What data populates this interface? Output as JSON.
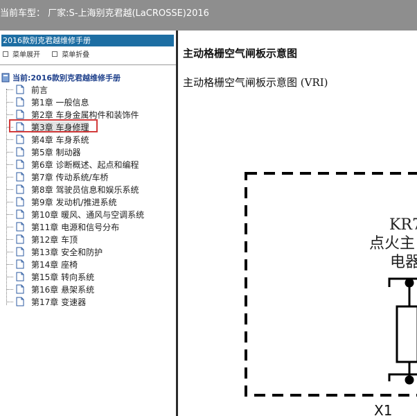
{
  "header": {
    "vehicle_text": "当前车型： 厂家:S-上海别克君越(LaCROSSE)2016"
  },
  "sidebar": {
    "manual_title": "2016款别克君越维修手册",
    "menu": {
      "expand_label": "菜单展开",
      "collapse_label": "菜单折叠"
    },
    "root_label": "当前:2016款别克君越维修手册",
    "items": [
      {
        "label": "前言"
      },
      {
        "label": "第1章 一般信息"
      },
      {
        "label": "第2章 车身金属构件和装饰件"
      },
      {
        "label": "第3章 车身修理"
      },
      {
        "label": "第4章 车身系统"
      },
      {
        "label": "第5章 制动器"
      },
      {
        "label": "第6章 诊断概述、起点和编程"
      },
      {
        "label": "第7章 传动系统/车桥"
      },
      {
        "label": "第8章 驾驶员信息和娱乐系统"
      },
      {
        "label": "第9章 发动机/推进系统"
      },
      {
        "label": "第10章 暖风、通风与空调系统"
      },
      {
        "label": "第11章 电源和信号分布"
      },
      {
        "label": "第12章 车顶"
      },
      {
        "label": "第13章 安全和防护"
      },
      {
        "label": "第14章 座椅"
      },
      {
        "label": "第15章 转向系统"
      },
      {
        "label": "第16章 悬架系统"
      },
      {
        "label": "第17章 变速器"
      }
    ],
    "selected_index": 3
  },
  "content": {
    "title": "主动格栅空气闸板示意图",
    "subtitle": "主动格栅空气闸板示意图 (VRI)",
    "diagram": {
      "relay_code": "KR7",
      "label_line1": "点火主",
      "label_line2": "电器",
      "connector": "X1"
    }
  },
  "colors": {
    "topbar": "#8e8e8e",
    "header_bar": "#1d6ea3",
    "selection_outline": "#d23b3b"
  }
}
